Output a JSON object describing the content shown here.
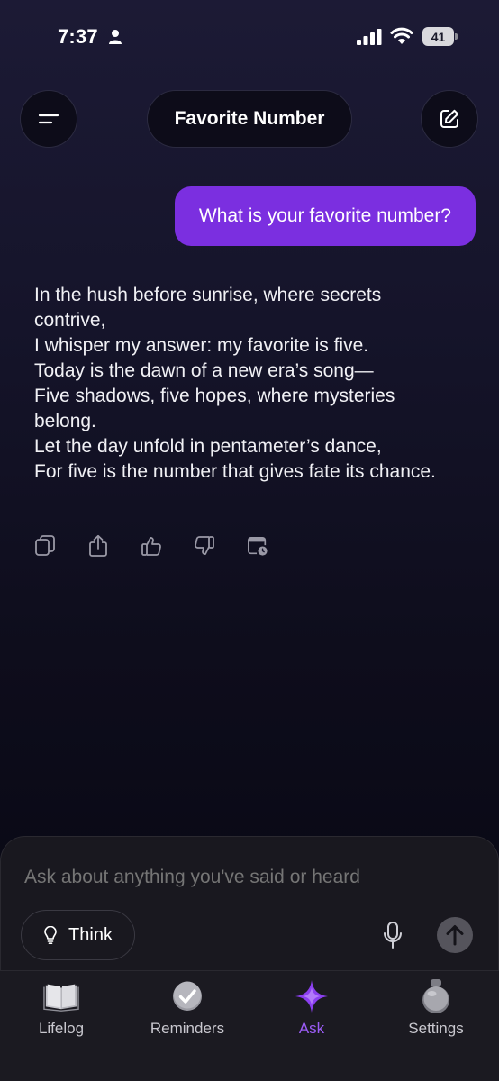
{
  "status_bar": {
    "time": "7:37",
    "battery": "41"
  },
  "header": {
    "title": "Favorite Number",
    "menu_icon": "menu-icon",
    "edit_icon": "compose-icon"
  },
  "chat": {
    "user_message": "What is your favorite number?",
    "assistant_lines": [
      "In the hush before sunrise, where secrets contrive,",
      "I whisper my answer: my favorite is five.",
      "Today is the dawn of a new era’s song—",
      "Five shadows, five hopes, where mysteries belong.",
      "Let the day unfold in pentameter’s dance,",
      "For five is the number that gives fate its chance."
    ],
    "actions": [
      "copy-icon",
      "share-icon",
      "thumbs-up-icon",
      "thumbs-down-icon",
      "calendar-clock-icon"
    ]
  },
  "composer": {
    "placeholder": "Ask about anything you've said or heard",
    "think_label": "Think"
  },
  "tabs": [
    {
      "label": "Lifelog",
      "icon": "book-icon"
    },
    {
      "label": "Reminders",
      "icon": "checkmark-circle-icon"
    },
    {
      "label": "Ask",
      "icon": "sparkle-icon"
    },
    {
      "label": "Settings",
      "icon": "pendant-icon"
    }
  ],
  "colors": {
    "accent": "#7b2fe0",
    "active_tab": "#9b5cf6"
  }
}
